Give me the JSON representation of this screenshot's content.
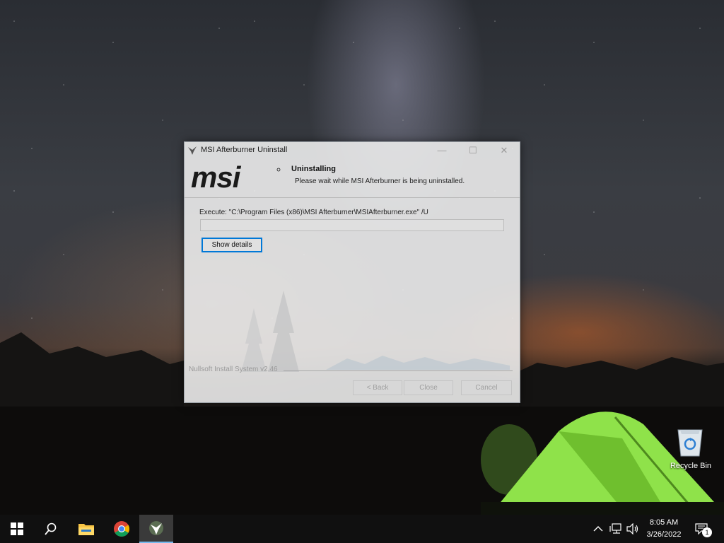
{
  "dialog": {
    "title": "MSI Afterburner Uninstall",
    "header_title": "Uninstalling",
    "header_subtitle": "Please wait while MSI Afterburner is being uninstalled.",
    "execute_text": "Execute: \"C:\\Program Files (x86)\\MSI Afterburner\\MSIAfterburner.exe\" /U",
    "progress_percent": 0,
    "show_details_label": "Show details",
    "installer_brand": "Nullsoft Install System v2.46",
    "logo_text": "msi",
    "buttons": {
      "back": "< Back",
      "close": "Close",
      "cancel": "Cancel"
    }
  },
  "desktop": {
    "recycle_bin_label": "Recycle Bin"
  },
  "taskbar": {
    "items": [
      "start-icon",
      "search-icon",
      "file-explorer-icon",
      "chrome-icon",
      "msi-afterburner-icon"
    ],
    "clock_time": "8:05 AM",
    "clock_date": "3/26/2022",
    "notification_count": "1"
  },
  "colors": {
    "accent": "#0078d7",
    "taskbar": "#101010",
    "tent": "#8fe24a"
  }
}
